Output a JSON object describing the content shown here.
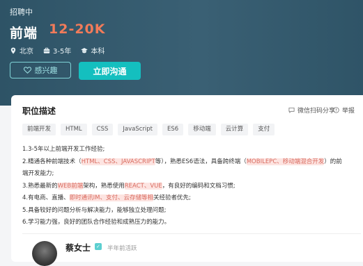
{
  "header": {
    "status": "招聘中",
    "title": "前端",
    "salary": "12-20K",
    "location": "北京",
    "experience": "3-5年",
    "education": "本科",
    "interest_label": "感兴趣",
    "chat_label": "立即沟通"
  },
  "card": {
    "title": "职位描述",
    "wechat_share": "微信扫码分享",
    "report": "举报",
    "tags": [
      "前端开发",
      "HTML",
      "CSS",
      "JavaScript",
      "ES6",
      "移动端",
      "云计算",
      "支付"
    ],
    "desc": {
      "line1": "1.3-5年以上前端开发工作经验;",
      "line2_a": "2.精通各种前端技术（",
      "line2_hl1": "HTML、CSS、JAVASCRIPT",
      "line2_b": "等），熟悉ES6语法，具备跨终端（",
      "line2_hl2": "MOBILEPC、移动端混合开发",
      "line2_c": "）的前",
      "line3": "端开发能力;",
      "line4_a": "3.熟悉最新的",
      "line4_hl1": "WEB前端",
      "line4_b": "架构，熟悉使用",
      "line4_hl2": "REACT、VUE",
      "line4_c": "，有良好的编码和文档习惯;",
      "line5_a": "4.有电商、直播、",
      "line5_hl1": "即时通讯IM、支付、云存储等相",
      "line5_b": "关经验者优先;",
      "line6": "5.具备较好的问题分析与解决能力，能够独立处理问题;",
      "line7": "6.学习能力强，良好的团队合作经验和成熟压力的能力。"
    },
    "recruiter": {
      "name": "蔡女士",
      "active": "半年前活跃"
    }
  },
  "colors": {
    "header_bg": "#2e5366",
    "salary": "#f17b5a",
    "accent": "#14bfbf",
    "highlight_text": "#d86a5e",
    "highlight_bg": "#fde4e1"
  }
}
